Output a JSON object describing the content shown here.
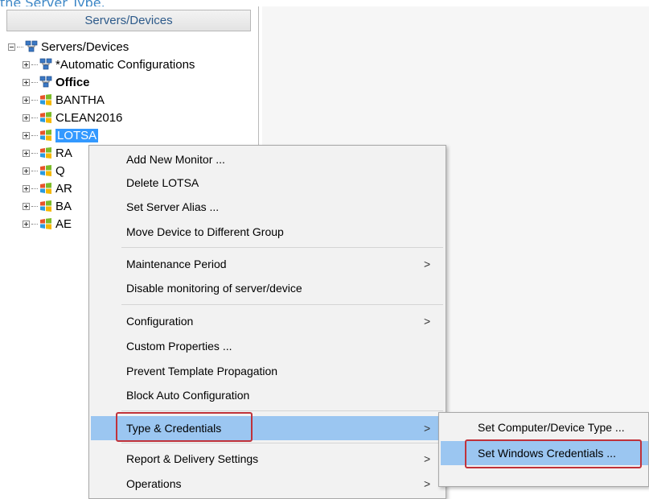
{
  "top_link": "the Server Type.",
  "panel": {
    "header": "Servers/Devices",
    "root_label": "Servers/Devices",
    "items": [
      {
        "label": "*Automatic Configurations",
        "icon": "server-group-icon",
        "bold": false
      },
      {
        "label": "Office",
        "icon": "server-group-icon",
        "bold": true
      },
      {
        "label": "BANTHA",
        "icon": "windows-server-icon",
        "bold": false
      },
      {
        "label": "CLEAN2016",
        "icon": "windows-server-icon",
        "bold": false
      },
      {
        "label": "LOTSA",
        "icon": "windows-server-icon",
        "bold": false,
        "selected": true
      },
      {
        "label": "RA",
        "icon": "windows-server-icon",
        "bold": false
      },
      {
        "label": "Q",
        "icon": "windows-server-icon",
        "bold": false
      },
      {
        "label": "AR",
        "icon": "windows-server-icon",
        "bold": false
      },
      {
        "label": "BA",
        "icon": "windows-server-icon",
        "bold": false
      },
      {
        "label": "AE",
        "icon": "windows-server-icon",
        "bold": false
      }
    ]
  },
  "context_menu": {
    "items": [
      {
        "label": "Add New Monitor ..."
      },
      {
        "label": "Delete LOTSA"
      },
      {
        "label": "Set Server Alias ..."
      },
      {
        "label": "Move Device to Different Group"
      },
      {
        "label": "Maintenance Period",
        "submenu": true
      },
      {
        "label": "Disable monitoring of server/device"
      },
      {
        "label": "Configuration",
        "submenu": true
      },
      {
        "label": "Custom Properties ..."
      },
      {
        "label": "Prevent Template Propagation"
      },
      {
        "label": "Block Auto Configuration"
      },
      {
        "label": "Type & Credentials",
        "submenu": true,
        "highlighted": true
      },
      {
        "label": "Report & Delivery Settings",
        "submenu": true
      },
      {
        "label": "Operations",
        "submenu": true
      }
    ],
    "arrow_glyph": ">"
  },
  "sub_menu": {
    "items": [
      {
        "label": "Set Computer/Device Type ..."
      },
      {
        "label": "Set Windows Credentials ...",
        "highlighted": true
      }
    ]
  },
  "colors": {
    "highlight": "#9bc6f1",
    "selection": "#3399ff",
    "callout_border": "#c0323a"
  }
}
